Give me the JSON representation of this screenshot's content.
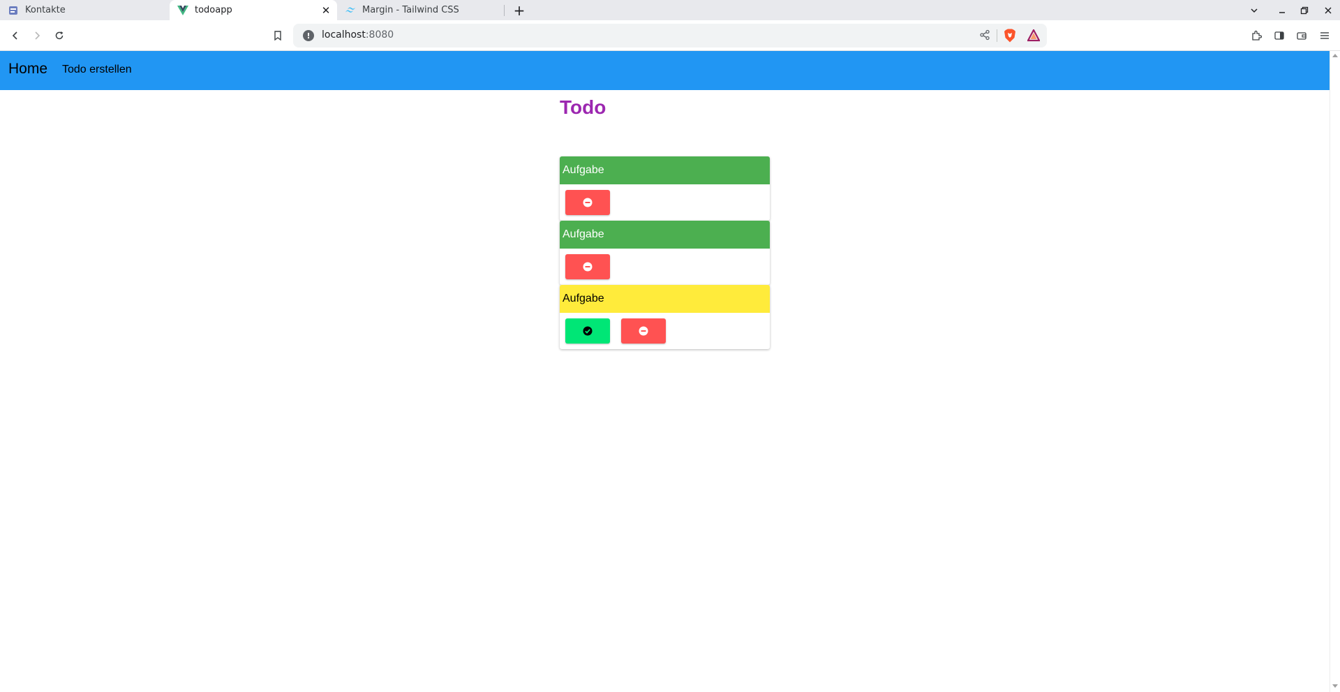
{
  "browser": {
    "tabs": [
      {
        "title": "Kontakte",
        "icon": "contacts-page-icon",
        "active": false
      },
      {
        "title": "todoapp",
        "icon": "vue-logo-icon",
        "active": true
      },
      {
        "title": "Margin - Tailwind CSS",
        "icon": "tailwind-logo-icon",
        "active": false
      }
    ],
    "address": {
      "host": "localhost",
      "port": ":8080"
    },
    "colors": {
      "tabstrip": "#e8e9ed",
      "omnibox": "#f1f3f4"
    }
  },
  "nav": {
    "home_label": "Home",
    "create_label": "Todo erstellen",
    "color": "#2196f3"
  },
  "page": {
    "title": "Todo",
    "title_color": "#9c27b0"
  },
  "todos": [
    {
      "title": "Aufgabe",
      "status_color": "#4caf50",
      "actions": [
        "remove"
      ]
    },
    {
      "title": "Aufgabe",
      "status_color": "#4caf50",
      "actions": [
        "remove"
      ]
    },
    {
      "title": "Aufgabe",
      "status_color": "#ffeb3b",
      "actions": [
        "complete",
        "remove"
      ]
    }
  ],
  "button_colors": {
    "remove": "#ff5252",
    "complete": "#00e676"
  }
}
